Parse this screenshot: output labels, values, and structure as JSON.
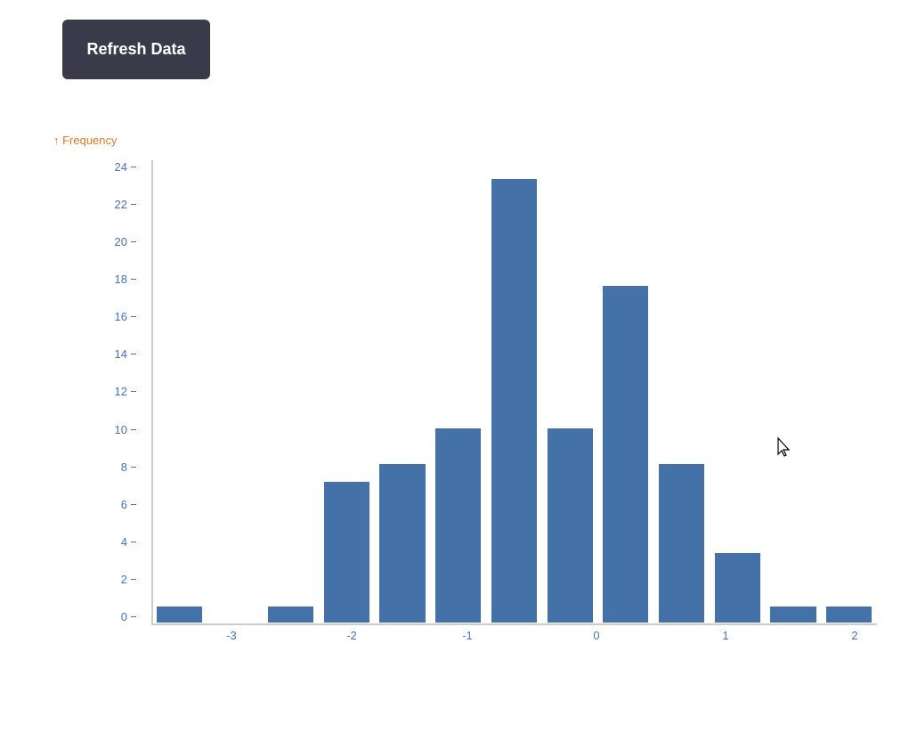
{
  "button": {
    "label": "Refresh Data"
  },
  "chart": {
    "y_axis_label": "↑ Frequency",
    "y_ticks": [
      0,
      2,
      4,
      6,
      8,
      10,
      12,
      14,
      16,
      18,
      20,
      22,
      24
    ],
    "x_ticks": [
      "-3",
      "-2",
      "-1",
      "0",
      "1",
      "2"
    ],
    "bars": [
      {
        "label": "-3.5 to -3",
        "value": 1
      },
      {
        "label": "-3 to -2.5",
        "value": 0
      },
      {
        "label": "-2.5 to -2",
        "value": 1
      },
      {
        "label": "-2 to -1.5",
        "value": 8
      },
      {
        "label": "-1.5 to -1",
        "value": 9
      },
      {
        "label": "-1 to -0.5",
        "value": 11
      },
      {
        "label": "-0.5 to 0",
        "value": 25
      },
      {
        "label": "0 to 0.5",
        "value": 11
      },
      {
        "label": "0.5 to 1",
        "value": 19
      },
      {
        "label": "1 to 1.5",
        "value": 9
      },
      {
        "label": "1.5 to 2",
        "value": 4
      },
      {
        "label": "2 to 2.5",
        "value": 1
      },
      {
        "label": "2.5 to 3",
        "value": 1
      }
    ],
    "max_value": 26,
    "bar_color": "#4472a8"
  }
}
